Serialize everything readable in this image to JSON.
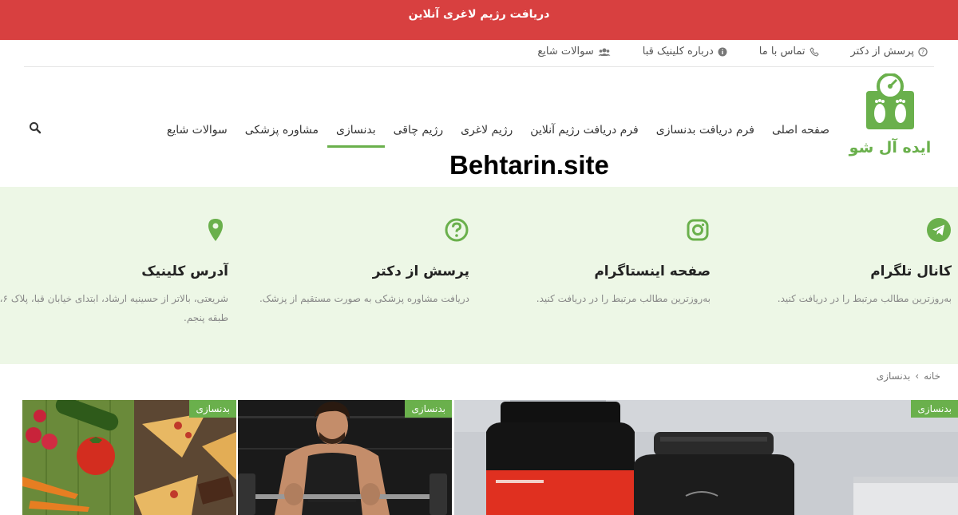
{
  "banner": {
    "text": "دریافت رژیم لاغری آنلاین"
  },
  "top_links": [
    {
      "label": "پرسش از دکتر",
      "icon": "question-circle-icon"
    },
    {
      "label": "تماس با ما",
      "icon": "phone-icon"
    },
    {
      "label": "درباره کلینیک قبا",
      "icon": "info-circle-icon"
    },
    {
      "label": "سوالات شایع",
      "icon": "users-icon"
    }
  ],
  "logo": {
    "text": "ایده آل شو",
    "icon": "scale-feet-icon"
  },
  "nav": {
    "items": [
      "صفحه اصلی",
      "فرم دریافت بدنسازی",
      "فرم دریافت رژیم آنلاین",
      "رژیم لاغری",
      "رژیم چاقی",
      "بدنسازی",
      "مشاوره پزشکی",
      "سوالات شایع"
    ],
    "active": "بدنسازی"
  },
  "watermark": "Behtarin.site",
  "features": [
    {
      "title": "کانال تلگرام",
      "desc": "به‌روزترین مطالب مرتبط را در دریافت کنید.",
      "icon": "telegram-icon"
    },
    {
      "title": "صفحه اینستاگرام",
      "desc": "به‌روزترین مطالب مرتبط را در دریافت کنید.",
      "icon": "instagram-icon"
    },
    {
      "title": "پرسش از دکتر",
      "desc": "دریافت مشاوره پزشکی به صورت مستقیم از پزشک.",
      "icon": "question-circle-icon"
    },
    {
      "title": "آدرس کلینیک",
      "desc": "شریعتی، بالاتر از حسینیه ارشاد، ابتدای خیابان قبا، پلاک ۶، طبقه پنجم.",
      "icon": "map-pin-icon"
    }
  ],
  "breadcrumb": {
    "home": "خانه",
    "separator": "›",
    "current": "بدنسازی"
  },
  "posts": [
    {
      "tag": "بدنسازی",
      "image": "supplement-jars"
    },
    {
      "tag": "بدنسازی",
      "image": "bodybuilder-barbell"
    },
    {
      "tag": "بدنسازی",
      "image": "pizza-vegetables"
    }
  ],
  "colors": {
    "banner": "#d84040",
    "accent": "#6ab04c",
    "feature_bg": "#edf7e6"
  }
}
